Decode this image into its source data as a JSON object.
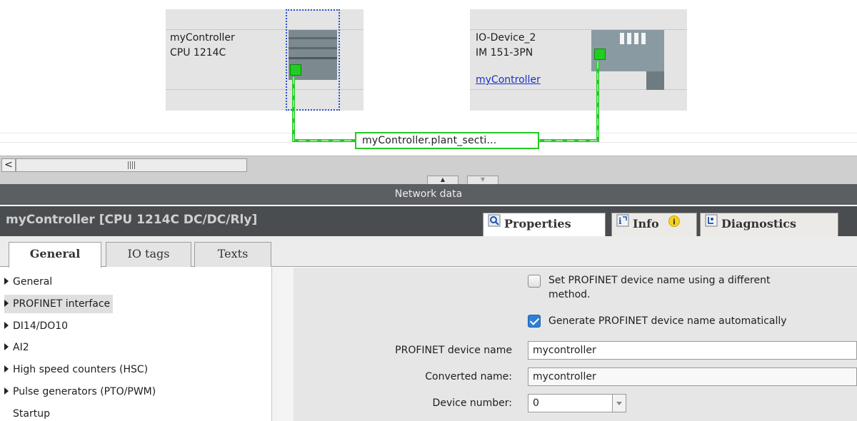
{
  "network": {
    "controller": {
      "name": "myController",
      "type": "CPU 1214C"
    },
    "io_device": {
      "name": "IO-Device_2",
      "type": "IM 151-3PN",
      "assigned_controller": "myController"
    },
    "subnet_label": "myController.plant_secti..."
  },
  "scrollbar": {
    "left_arrow": "<",
    "grip": "III"
  },
  "inspector": {
    "bar_title": "Network data",
    "object_title": "myController [CPU 1214C DC/DC/Rly]",
    "right_tabs": {
      "properties": "Properties",
      "info": "Info",
      "diagnostics": "Diagnostics"
    },
    "left_tabs": {
      "general": "General",
      "io_tags": "IO tags",
      "texts": "Texts"
    }
  },
  "nav": {
    "items": [
      {
        "label": "General",
        "expandable": true
      },
      {
        "label": "PROFINET interface",
        "expandable": true,
        "selected": true
      },
      {
        "label": "DI14/DO10",
        "expandable": true
      },
      {
        "label": "AI2",
        "expandable": true
      },
      {
        "label": "High speed counters (HSC)",
        "expandable": true
      },
      {
        "label": "Pulse generators (PTO/PWM)",
        "expandable": true
      },
      {
        "label": "Startup",
        "expandable": false
      }
    ]
  },
  "properties": {
    "set_name_diff_line1": "Set PROFINET device name using a different",
    "set_name_diff_line2": "method.",
    "set_name_diff_checked": false,
    "generate_auto": "Generate PROFINET device name automatically",
    "generate_auto_checked": true,
    "device_name_label": "PROFINET device name",
    "device_name_value": "mycontroller",
    "converted_name_label": "Converted name:",
    "converted_name_value": "mycontroller",
    "device_number_label": "Device number:",
    "device_number_value": "0"
  },
  "colors": {
    "link": "#1a31c8",
    "ethernet": "#22cc22",
    "selection": "#2b4fd1",
    "checkbox_checked": "#2f7fd6"
  },
  "icons": {
    "properties": "magnifier-icon",
    "info": "info-icon",
    "diagnostics": "diagnostics-icon"
  }
}
